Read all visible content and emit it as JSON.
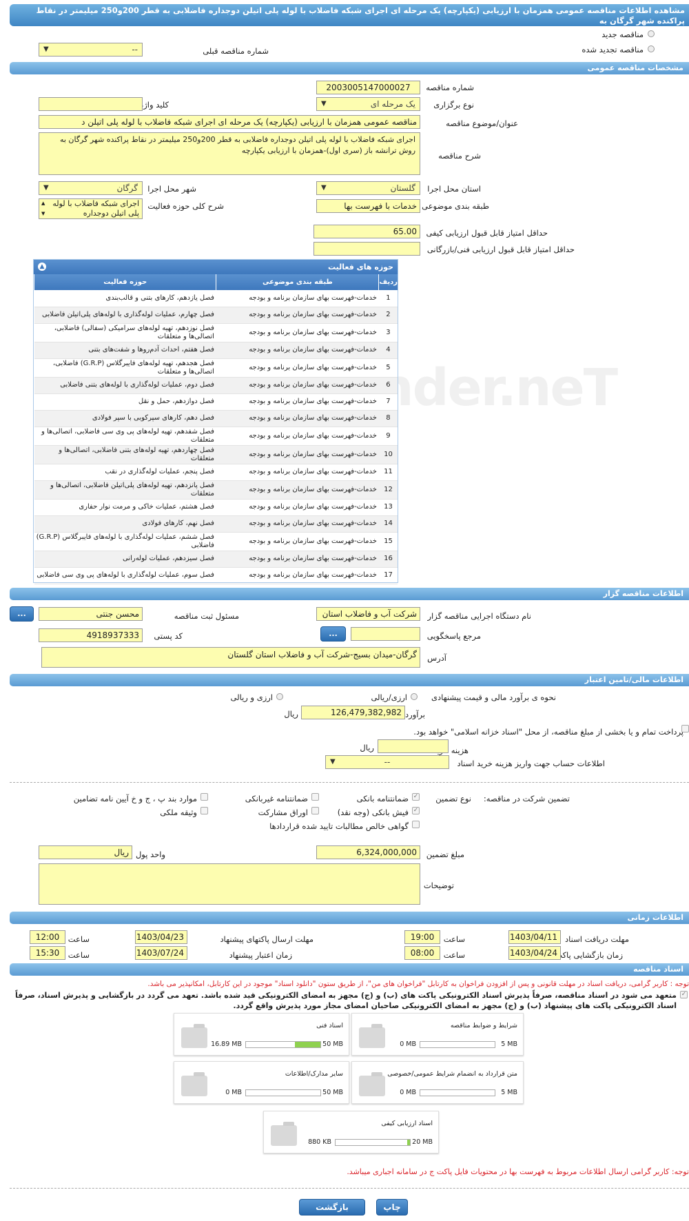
{
  "header": {
    "title": "مشاهده اطلاعات مناقصه عمومی همزمان با ارزیابی (یکپارچه) یک مرحله ای اجرای شبکه فاضلاب با لوله پلی اتیلن دوجداره فاضلابی به قطر 200و250 میلیمتر در نقاط پراکنده شهر گرگان به"
  },
  "tender_type": {
    "new": "مناقصه جدید",
    "renewed": "مناقصه تجدید شده",
    "prev_number_label": "شماره مناقصه قبلی",
    "prev_number_value": "--"
  },
  "general": {
    "section": "مشخصات مناقصه عمومی",
    "number_label": "شماره مناقصه",
    "number_value": "2003005147000027",
    "holding_label": "نوع برگزاری",
    "holding_value": "یک مرحله ای",
    "keyword_label": "کلید واژه",
    "keyword_value": "",
    "title_label": "عنوان/موضوع مناقصه",
    "title_value": "مناقصه عمومی همزمان با ارزیابی (یکپارچه) یک مرحله ای   اجرای شبکه فاضلاب  با لوله پلی اتیلن د",
    "desc_label": "شرح مناقصه",
    "desc_value": "اجرای شبکه فاضلاب  با لوله پلی اتیلن دوجداره فاضلابی به قطر 200و250 میلیمتر در نقاط پراکنده شهر گرگان به روش ترانشه باز (سری اول)-همزمان با ارزیابی یکپارچه",
    "province_label": "استان محل اجرا",
    "province_value": "گلستان",
    "city_label": "شهر محل اجرا",
    "city_value": "گرگان",
    "category_label": "طبقه بندی موضوعی",
    "category_value": "خدمات با فهرست بها",
    "activity_desc_label": "شرح کلی حوزه فعالیت",
    "activity_desc_value": "اجرای شبکه فاضلاب  با لوله پلی اتیلن دوجداره",
    "min_quality_label": "حداقل امتیاز قابل قبول ارزیابی کیفی",
    "min_quality_value": "65.00",
    "min_tech_label": "حداقل امتیاز قابل قبول ارزیابی فنی/بازرگانی",
    "min_tech_value": ""
  },
  "activities": {
    "title": "حوزه های فعالیت",
    "headers": [
      "ردیف",
      "طبقه بندی موضوعی",
      "حوزه فعالیت"
    ],
    "rows": [
      [
        "1",
        "خدمات-فهرست بهای سازمان برنامه و بودجه",
        "فصل یازدهم، کارهای بتنی و قالب‌بندی"
      ],
      [
        "2",
        "خدمات-فهرست بهای سازمان برنامه و بودجه",
        "فصل چهارم، عملیات لوله‌گذاری با لوله‌های پلی‌اتیلن فاضلابی"
      ],
      [
        "3",
        "خدمات-فهرست بهای سازمان برنامه و بودجه",
        "فصل نوزدهم، تهیه لوله‌های سرامیکی (سفالی) فاضلابی، اتصالی‌ها و متعلقات"
      ],
      [
        "4",
        "خدمات-فهرست بهای سازمان برنامه و بودجه",
        "فصل هفتم، احداث آدم‌روها و شفت‌های بتنی"
      ],
      [
        "5",
        "خدمات-فهرست بهای سازمان برنامه و بودجه",
        "فصل هجدهم، تهیه لوله‌های فایبرگلاس (G.R.P) فاضلابی، اتصالی‌ها و متعلقات"
      ],
      [
        "6",
        "خدمات-فهرست بهای سازمان برنامه و بودجه",
        "فصل دوم، عملیات لوله‌گذاری با لوله‌های بتنی فاضلابی"
      ],
      [
        "7",
        "خدمات-فهرست بهای سازمان برنامه و بودجه",
        "فصل دوازدهم، حمل و نقل"
      ],
      [
        "8",
        "خدمات-فهرست بهای سازمان برنامه و بودجه",
        "فصل دهم، کارهای سپرکوبی با سپر فولادی"
      ],
      [
        "9",
        "خدمات-فهرست بهای سازمان برنامه و بودجه",
        "فصل شفدهم، تهیه لوله‌های پی وی سی فاضلابی، اتصالی‌ها و متعلقات"
      ],
      [
        "10",
        "خدمات-فهرست بهای سازمان برنامه و بودجه",
        "فصل چهاردهم، تهیه لوله‌های بتنی فاضلابی، اتصالی‌ها و متعلقات"
      ],
      [
        "11",
        "خدمات-فهرست بهای سازمان برنامه و بودجه",
        "فصل پنجم، عملیات لوله‌گذاری در نقب"
      ],
      [
        "12",
        "خدمات-فهرست بهای سازمان برنامه و بودجه",
        "فصل پانزدهم، تهیه لوله‌های پلی‌اتیلن فاضلابی، اتصالی‌ها و متعلقات"
      ],
      [
        "13",
        "خدمات-فهرست بهای سازمان برنامه و بودجه",
        "فصل هشتم، عملیات خاکی و مرمت نوار حفاری"
      ],
      [
        "14",
        "خدمات-فهرست بهای سازمان برنامه و بودجه",
        "فصل نهم، کارهای فولادی"
      ],
      [
        "15",
        "خدمات-فهرست بهای سازمان برنامه و بودجه",
        "فصل ششم، عملیات لوله‌گذاری با لوله‌های فایبرگلاس (G.R.P) فاضلابی"
      ],
      [
        "16",
        "خدمات-فهرست بهای سازمان برنامه و بودجه",
        "فصل سیزدهم، عملیات لوله‌رانی"
      ],
      [
        "17",
        "خدمات-فهرست بهای سازمان برنامه و بودجه",
        "فصل سوم، عملیات لوله‌گذاری با لوله‌های پی وی سی فاضلابی"
      ]
    ]
  },
  "organizer": {
    "section": "اطلاعات مناقصه گزار",
    "org_label": "نام دستگاه اجرایی مناقصه گزار",
    "org_value": "شرکت آب و فاضلاب استان",
    "resp_label": "مسئول ثبت مناقصه",
    "resp_value": "محسن جنتی",
    "ref_label": "مرجع پاسخگویی",
    "ref_value": "",
    "postal_label": "کد پستی",
    "postal_value": "4918937333",
    "address_label": "آدرس",
    "address_value": "گرگان-میدان بسیج-شرکت آب و فاضلاب استان گلستان",
    "dots": "..."
  },
  "finance": {
    "section": "اطلاعات مالی/تامین اعتبار",
    "method_label": "نحوه ی برآورد مالی و قیمت پیشنهادی",
    "opt1": "ارزی/ریالی",
    "opt2": "ارزی و ریالی",
    "estimate_label": "برآورد مالی",
    "estimate_value": "126,479,382,982",
    "estimate_unit": "ریال",
    "treasury_text": "پرداخت تمام و یا بخشی از مبلغ مناقصه، از محل \"اسناد خزانه اسلامی\" خواهد بود.",
    "doc_cost_label": "هزینه خرید اسناد",
    "doc_cost_value": "",
    "doc_cost_unit": "ریال",
    "account_label": "اطلاعات حساب جهت واریز هزینه خرید اسناد",
    "account_value": "--",
    "guarantee_label": "تضمین شرکت در مناقصه:",
    "guarantee_type_label": "نوع تضمین",
    "g1": "ضمانتنامه بانکی",
    "g2": "ضمانتنامه غیربانکی",
    "g3": "موارد بند پ ، ج و خ آیین نامه تضامین",
    "g4": "فیش بانکی (وجه نقد)",
    "g5": "اوراق مشارکت",
    "g6": "وثیقه ملکی",
    "g7": "گواهی خالص مطالبات تایید شده قراردادها",
    "amount_label": "مبلغ تضمین",
    "amount_value": "6,324,000,000",
    "currency_label": "واحد پول",
    "currency_value": "ریال",
    "notes_label": "توضیحات",
    "notes_value": ""
  },
  "timing": {
    "section": "اطلاعات زمانی",
    "receive_label": "مهلت دریافت اسناد",
    "receive_date": "1403/04/11",
    "receive_time": "19:00",
    "send_label": "مهلت ارسال پاکتهای پیشنهاد",
    "send_date": "1403/04/23",
    "send_time": "12:00",
    "open_label": "زمان بازگشایی پاکت ها",
    "open_date": "1403/04/24",
    "open_time": "08:00",
    "valid_label": "زمان اعتبار پیشنهاد",
    "valid_date": "1403/07/24",
    "valid_time": "15:30",
    "time_label": "ساعت"
  },
  "docs": {
    "section": "اسناد مناقصه",
    "note1": "توجه : کاربر گرامی، دریافت اسناد در مهلت قانونی و پس از افزودن فراخوان به کارتابل \"فراخوان های من\"، از طریق ستون \"دانلود اسناد\" موجود در این کارتابل، امکانپذیر می باشد.",
    "note2": "متعهد می شود در اسناد مناقصه، صرفاً پذیرش اسناد الکترونیکی پاکت های (ب) و (ج) مجهز به امضای الکترونیکی قید شده باشد. تعهد می گردد در بازگشایی و پذیرش اسناد، صرفاً اسناد الکترونیکی پاکت های پیشنهاد (ب) و (ج) مجهز به امضای الکترونیکی صاحبان امضای مجاز مورد پذیرش واقع گردد.",
    "cards": [
      {
        "title": "شرایط و ضوابط مناقصه",
        "used": "0 MB",
        "max": "5 MB",
        "fill": 0
      },
      {
        "title": "اسناد فنی",
        "used": "16.89 MB",
        "max": "50 MB",
        "fill": 0.34
      },
      {
        "title": "متن قرارداد به انضمام شرایط عمومی/خصوصی",
        "used": "0 MB",
        "max": "5 MB",
        "fill": 0
      },
      {
        "title": "سایر مدارک/اطلاعات",
        "used": "0 MB",
        "max": "50 MB",
        "fill": 0
      },
      {
        "title": "اسناد ارزیابی کیفی",
        "used": "880 KB",
        "max": "20 MB",
        "fill": 0.04
      }
    ],
    "note3": "توجه: کاربر گرامی ارسال اطلاعات مربوط به فهرست بها در محتویات فایل پاکت ج در سامانه اجباری میباشد."
  },
  "buttons": {
    "print": "چاپ",
    "back": "بازگشت"
  },
  "watermark": "AriaTender.neT"
}
